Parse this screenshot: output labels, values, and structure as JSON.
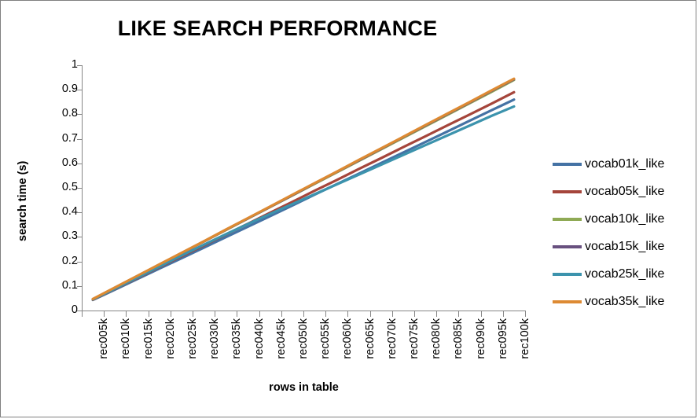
{
  "chart_data": {
    "type": "line",
    "title": "LIKE SEARCH PERFORMANCE",
    "xlabel": "rows in table",
    "ylabel": "search time (s)",
    "ylim": [
      0,
      1
    ],
    "ytick_step": 0.1,
    "yticks": [
      "1",
      "0.9",
      "0.8",
      "0.7",
      "0.6",
      "0.5",
      "0.4",
      "0.3",
      "0.2",
      "0.1",
      "0"
    ],
    "grid": false,
    "legend_position": "right",
    "categories": [
      "rec005k",
      "rec010k",
      "rec015k",
      "rec020k",
      "rec025k",
      "rec030k",
      "rec035k",
      "rec040k",
      "rec045k",
      "rec050k",
      "rec055k",
      "rec060k",
      "rec065k",
      "rec070k",
      "rec075k",
      "rec080k",
      "rec085k",
      "rec090k",
      "rec095k",
      "rec100k"
    ],
    "series": [
      {
        "name": "vocab01k_like",
        "color": "#4472A4",
        "values": [
          0.043,
          0.085,
          0.128,
          0.171,
          0.213,
          0.256,
          0.299,
          0.342,
          0.385,
          0.428,
          0.472,
          0.515,
          0.558,
          0.601,
          0.644,
          0.687,
          0.73,
          0.774,
          0.817,
          0.86
        ]
      },
      {
        "name": "vocab05k_like",
        "color": "#A5453B",
        "values": [
          0.044,
          0.088,
          0.132,
          0.177,
          0.221,
          0.265,
          0.31,
          0.354,
          0.399,
          0.443,
          0.488,
          0.532,
          0.577,
          0.621,
          0.666,
          0.71,
          0.755,
          0.799,
          0.844,
          0.89
        ]
      },
      {
        "name": "vocab10k_like",
        "color": "#8FAA55",
        "values": [
          0.046,
          0.093,
          0.14,
          0.187,
          0.234,
          0.281,
          0.328,
          0.375,
          0.422,
          0.469,
          0.516,
          0.563,
          0.61,
          0.657,
          0.704,
          0.751,
          0.798,
          0.845,
          0.892,
          0.94
        ]
      },
      {
        "name": "vocab15k_like",
        "color": "#68507F",
        "values": [
          0.046,
          0.093,
          0.14,
          0.187,
          0.234,
          0.281,
          0.329,
          0.376,
          0.423,
          0.47,
          0.518,
          0.565,
          0.612,
          0.659,
          0.707,
          0.754,
          0.801,
          0.848,
          0.896,
          0.943
        ]
      },
      {
        "name": "vocab25k_like",
        "color": "#3C93AD",
        "values": [
          0.045,
          0.089,
          0.134,
          0.179,
          0.224,
          0.268,
          0.311,
          0.353,
          0.394,
          0.434,
          0.474,
          0.514,
          0.554,
          0.594,
          0.634,
          0.674,
          0.714,
          0.754,
          0.794,
          0.832
        ]
      },
      {
        "name": "vocab35k_like",
        "color": "#DD8A33",
        "values": [
          0.047,
          0.094,
          0.141,
          0.188,
          0.235,
          0.282,
          0.33,
          0.377,
          0.424,
          0.472,
          0.519,
          0.566,
          0.614,
          0.661,
          0.708,
          0.756,
          0.803,
          0.85,
          0.898,
          0.945
        ]
      }
    ]
  }
}
